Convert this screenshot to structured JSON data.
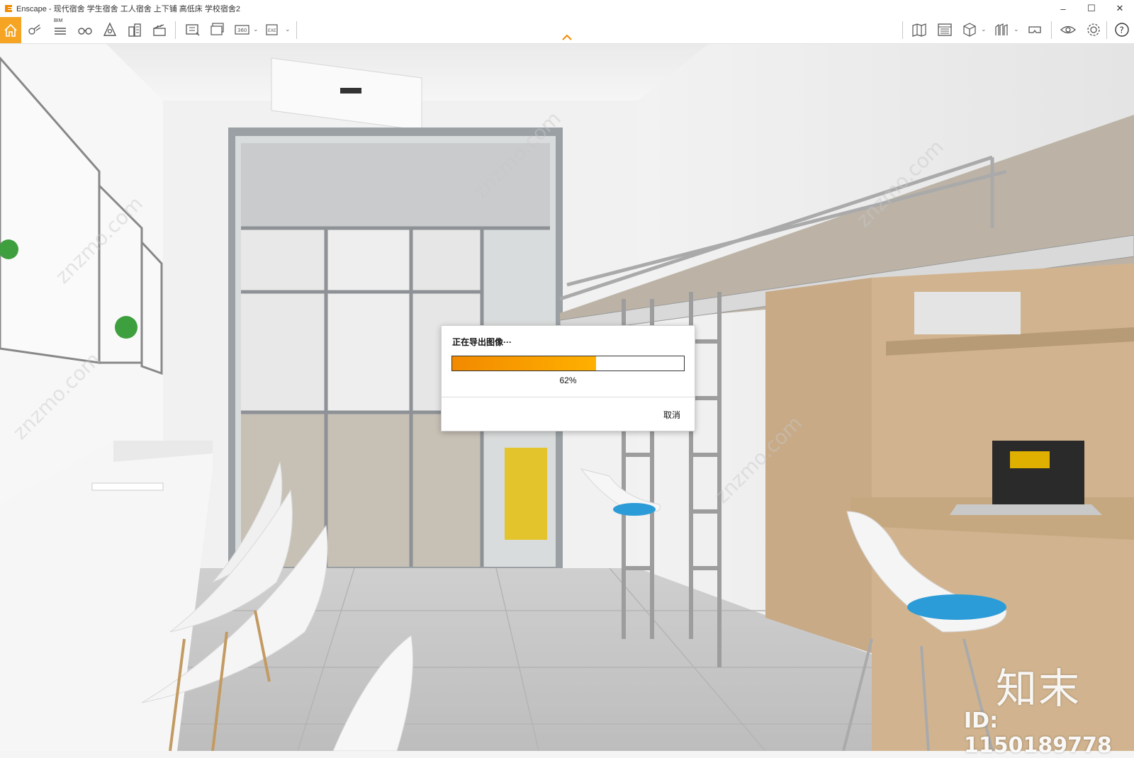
{
  "window": {
    "title": "Enscape - 现代宿舍 学生宿舍 工人宿舍 上下铺 高低床 学校宿舍2",
    "minimize": "–",
    "maximize": "☐",
    "close": "✕"
  },
  "toolbar": {
    "bim_label": "BIM",
    "left_icons": [
      "home-icon",
      "asset-library-icon",
      "bim-icon",
      "binoculars-icon",
      "view-mode-icon",
      "buildings-icon",
      "clapper-icon",
      "screenshot-icon",
      "batch-render-icon",
      "panorama-360-icon",
      "export-exe-icon"
    ],
    "right_icons": [
      "map-icon",
      "windows-icon",
      "cube-icon",
      "atmosphere-icon",
      "vr-headset-icon",
      "visual-settings-icon",
      "gear-icon",
      "help-icon"
    ],
    "accent_color": "#f5a523"
  },
  "dialog": {
    "title": "正在导出图像···",
    "progress_fraction": 0.62,
    "percent_text": "62%",
    "cancel_label": "取消"
  },
  "watermark": {
    "brand": "知末",
    "id_text": "ID: 1150189778"
  }
}
